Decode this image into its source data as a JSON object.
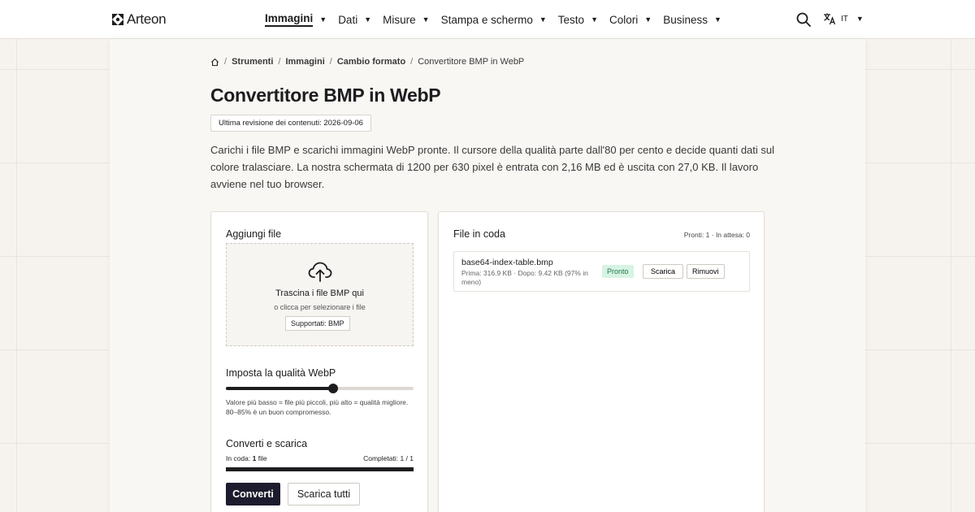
{
  "header": {
    "brand": "Arteon",
    "nav": [
      {
        "label": "Immagini",
        "active": true
      },
      {
        "label": "Dati",
        "active": false
      },
      {
        "label": "Misure",
        "active": false
      },
      {
        "label": "Stampa e schermo",
        "active": false
      },
      {
        "label": "Testo",
        "active": false
      },
      {
        "label": "Colori",
        "active": false
      },
      {
        "label": "Business",
        "active": false
      }
    ],
    "caret": "▼",
    "search_icon": "search-icon",
    "language": {
      "icon": "translate-icon",
      "code": "IT"
    }
  },
  "breadcrumb": {
    "home_icon": "home-icon",
    "separator": "/",
    "items": [
      "Strumenti",
      "Immagini",
      "Cambio formato"
    ],
    "current": "Convertitore BMP in WebP"
  },
  "page": {
    "title": "Convertitore BMP in WebP",
    "revision": "Ultima revisione dei contenuti: 2026-09-06",
    "intro": "Carichi i file BMP e scarichi immagini WebP pronte. Il cursore della qualità parte dall'80 per cento e decide quanti dati sul colore tralasciare. La nostra schermata di 1200 per 630 pixel è entrata con 2,16 MB ed è uscita con 27,0 KB. Il lavoro avviene nel tuo browser."
  },
  "upload": {
    "title": "Aggiungi file",
    "upload_icon": "cloud-upload-icon",
    "drop_text": "Trascina i file BMP qui",
    "click_text": "o clicca per selezionare i file",
    "supported": "Supportati: BMP"
  },
  "quality": {
    "title": "Imposta la qualità WebP",
    "value": 0.57,
    "help": "Valore più basso = file più piccoli, più alto = qualità migliore. 80–85% è un buon compromesso."
  },
  "convert": {
    "title": "Converti e scarica",
    "queue_prefix": "In coda: ",
    "queue_count": "1",
    "queue_suffix": " file",
    "completed": "Completati: 1 / 1",
    "progress": 1.0,
    "convert_label": "Converti",
    "download_all_label": "Scarica tutti"
  },
  "queue": {
    "title": "File in coda",
    "status": "Pronti: 1 · In attesa: 0",
    "files": [
      {
        "name": "base64-index-table.bmp",
        "meta": "Prima: 316.9 KB · Dopo: 9.42 KB (97% in meno)",
        "status": "Pronto",
        "download_label": "Scarica",
        "remove_label": "Rimuovi"
      }
    ]
  },
  "colors": {
    "accent_dark": "#1c1c2e",
    "ready_bg": "#d7f3e3",
    "ready_text": "#1f7a4a"
  }
}
